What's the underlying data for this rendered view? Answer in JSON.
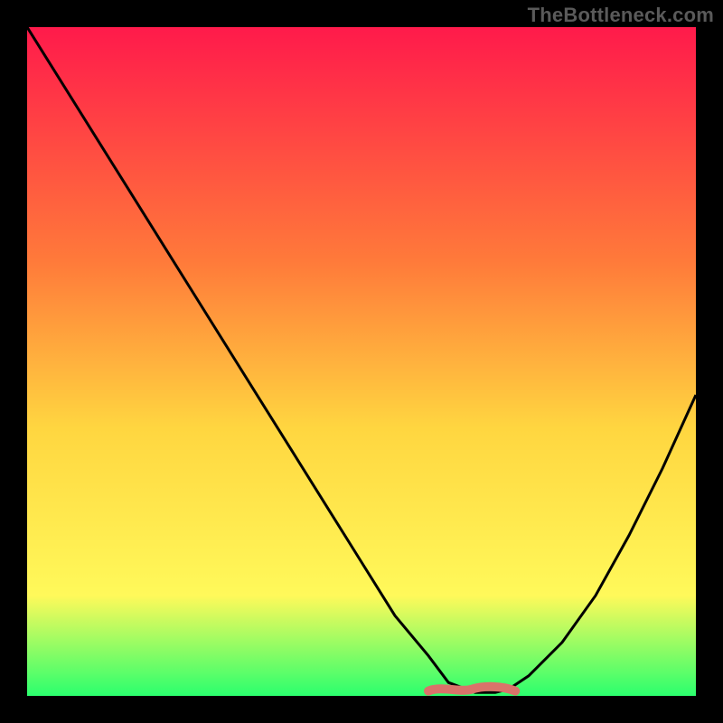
{
  "watermark": "TheBottleneck.com",
  "colors": {
    "gradient_top": "#ff1a4b",
    "gradient_mid1": "#ff7a3a",
    "gradient_mid2": "#ffd640",
    "gradient_mid3": "#fff95a",
    "gradient_bottom": "#2bff6e",
    "curve": "#000000",
    "marker": "#d9736a",
    "frame": "#000000"
  },
  "chart_data": {
    "type": "line",
    "title": "",
    "xlabel": "",
    "ylabel": "",
    "x": [
      0,
      5,
      10,
      15,
      20,
      25,
      30,
      35,
      40,
      45,
      50,
      55,
      60,
      63,
      67,
      70,
      72,
      75,
      80,
      85,
      90,
      95,
      100
    ],
    "values": [
      100,
      92,
      84,
      76,
      68,
      60,
      52,
      44,
      36,
      28,
      20,
      12,
      6,
      2,
      0.5,
      0.5,
      1,
      3,
      8,
      15,
      24,
      34,
      45
    ],
    "xlim": [
      0,
      100
    ],
    "ylim": [
      0,
      100
    ],
    "optimal_band": {
      "x_start": 60,
      "x_end": 73,
      "y": 1
    },
    "notes": "Black curve is relative bottleneck (%) vs position (%). Background is a vertical heat gradient from red (high bottleneck) to green (low). Salmon segment near x=60–73 marks the recommended zone."
  }
}
